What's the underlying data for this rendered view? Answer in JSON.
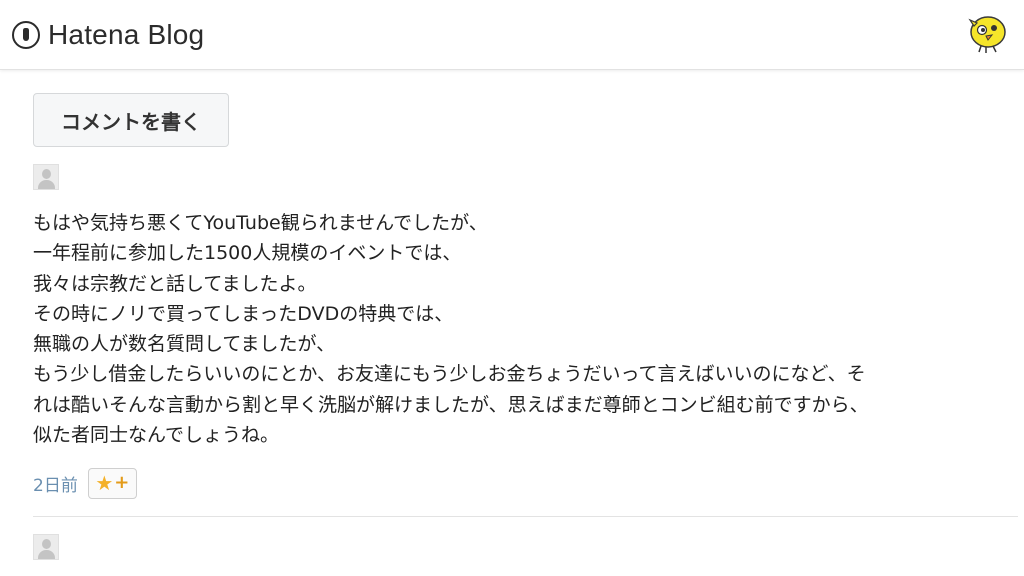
{
  "header": {
    "logo_text": "Hatena Blog",
    "logo_icon": "hatena-pen-icon",
    "user_avatar_icon": "yellow-bird-avatar-icon"
  },
  "comment_button": {
    "label": "コメントを書く"
  },
  "comment": {
    "author_avatar_icon": "default-user-avatar-icon",
    "lines": [
      "もはや気持ち悪くてYouTube観られませんでしたが、",
      "一年程前に参加した1500人規模のイベントでは、",
      "我々は宗教だと話してましたよ。",
      "その時にノリで買ってしまったDVDの特典では、",
      "無職の人が数名質問してましたが、",
      "もう少し借金したらいいのにとか、お友達にもう少しお金ちょうだいって言えばいいのになど、そ",
      "れは酷いそんな言動から割と早く洗脳が解けましたが、思えばまだ尊師とコンビ組む前ですから、",
      "似た者同士なんでしょうね。"
    ],
    "timestamp": "2日前",
    "star_button": {
      "star": "★",
      "plus": "+"
    }
  },
  "next_comment": {
    "author_avatar_icon": "default-user-avatar-icon"
  },
  "colors": {
    "timestamp": "#6a8fb0",
    "star": "#f4b128",
    "button_bg": "#f6f7f8",
    "avatar_bird": "#f5e52a"
  }
}
